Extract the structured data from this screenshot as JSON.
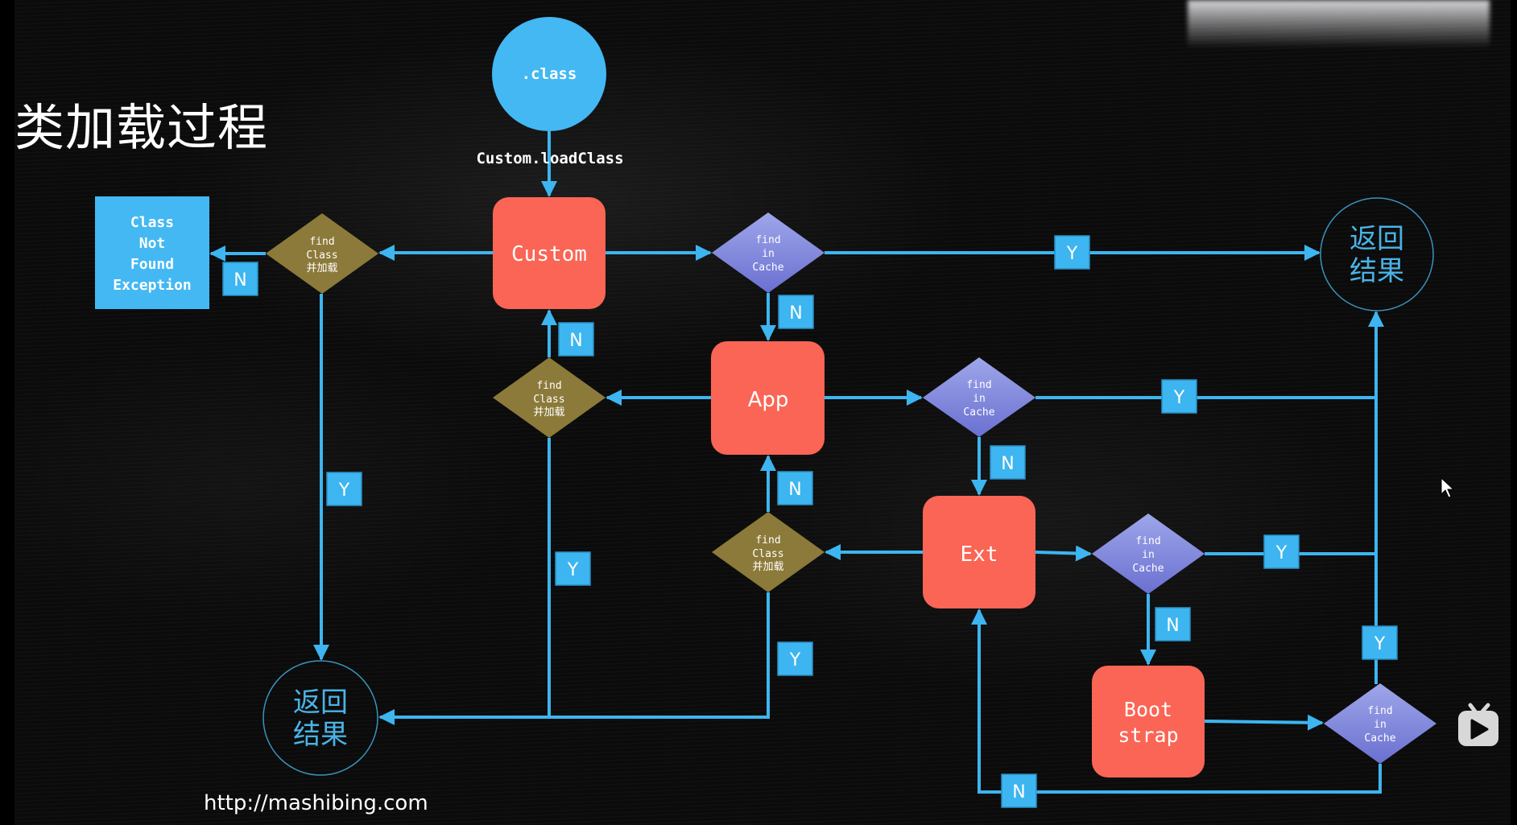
{
  "title": "类加载过程",
  "footer_url": "http://mashibing.com",
  "colors": {
    "connector": "#3db5f0",
    "start_circle": "#44b8f3",
    "loader_box": "#fa6555",
    "cache_diamond_top": "#9aa2e8",
    "cache_diamond_bottom": "#6f76d4",
    "load_diamond": "#8c7a3a",
    "label_box": "#3db5f0",
    "exception_box": "#44b8f3",
    "result_circle_stroke": "#3a93bd",
    "result_text": "#4ab3e6"
  },
  "nodes": {
    "start": {
      "label": ".class"
    },
    "start_call": {
      "label": "Custom.loadClass"
    },
    "custom": {
      "label": "Custom"
    },
    "app": {
      "label": "App"
    },
    "ext": {
      "label": "Ext"
    },
    "bootstrap": {
      "line1": "Boot",
      "line2": "strap"
    },
    "exception": {
      "line1": "Class",
      "line2": "Not",
      "line3": "Found",
      "line4": "Exception"
    },
    "cache_check": {
      "line1": "find",
      "line2": "in",
      "line3": "Cache"
    },
    "find_class": {
      "line1": "find",
      "line2": "Class",
      "line3": "并加载"
    },
    "result": {
      "line1": "返回",
      "line2": "结果"
    }
  },
  "edge_labels": {
    "yes": "Y",
    "no": "N"
  },
  "overlay": {
    "cursor_icon": "mouse-pointer",
    "player_icon": "tv-play-icon"
  }
}
